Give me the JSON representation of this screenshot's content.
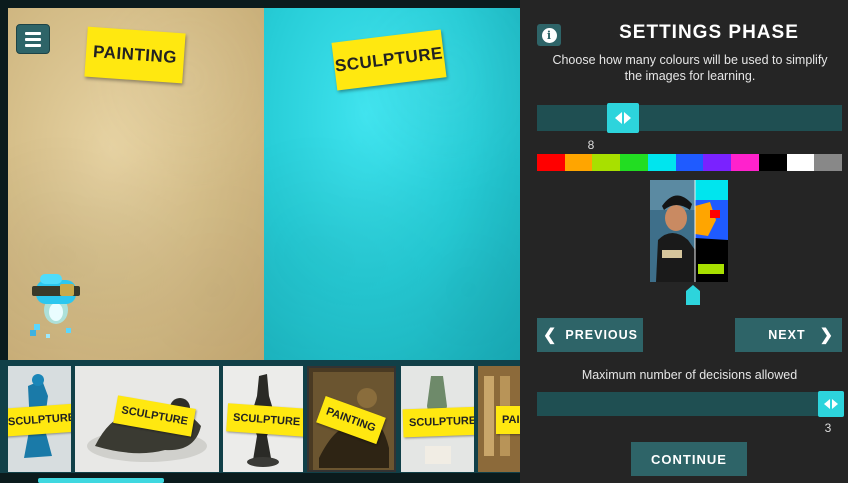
{
  "game": {
    "zones": {
      "painting_label": "PAINTING",
      "sculpture_label": "SCULPTURE"
    },
    "menu_icon": "hamburger-menu-icon",
    "tray": {
      "items": [
        {
          "tag": "SCULPTURE"
        },
        {
          "tag": "SCULPTURE"
        },
        {
          "tag": "SCULPTURE"
        },
        {
          "tag": "PAINTING"
        },
        {
          "tag": "SCULPTURE"
        },
        {
          "tag": "PAI"
        }
      ]
    }
  },
  "panel": {
    "info_icon": "info-icon",
    "title": "SETTINGS PHASE",
    "description": "Choose how many colours will be used to simplify the images for learning.",
    "colour_slider": {
      "value": "8",
      "value_fraction": 0.18
    },
    "palette": [
      "#ff0000",
      "#ffa500",
      "#a8e000",
      "#22dd22",
      "#00e5ee",
      "#1f5bff",
      "#7a22ff",
      "#ff22cc",
      "#000000",
      "#ffffff",
      "#888888"
    ],
    "previous_label": "PREVIOUS",
    "next_label": "NEXT",
    "decisions_label": "Maximum number of decisions allowed",
    "decisions_slider": {
      "value": "3",
      "value_fraction": 1.0
    },
    "continue_label": "CONTINUE"
  }
}
